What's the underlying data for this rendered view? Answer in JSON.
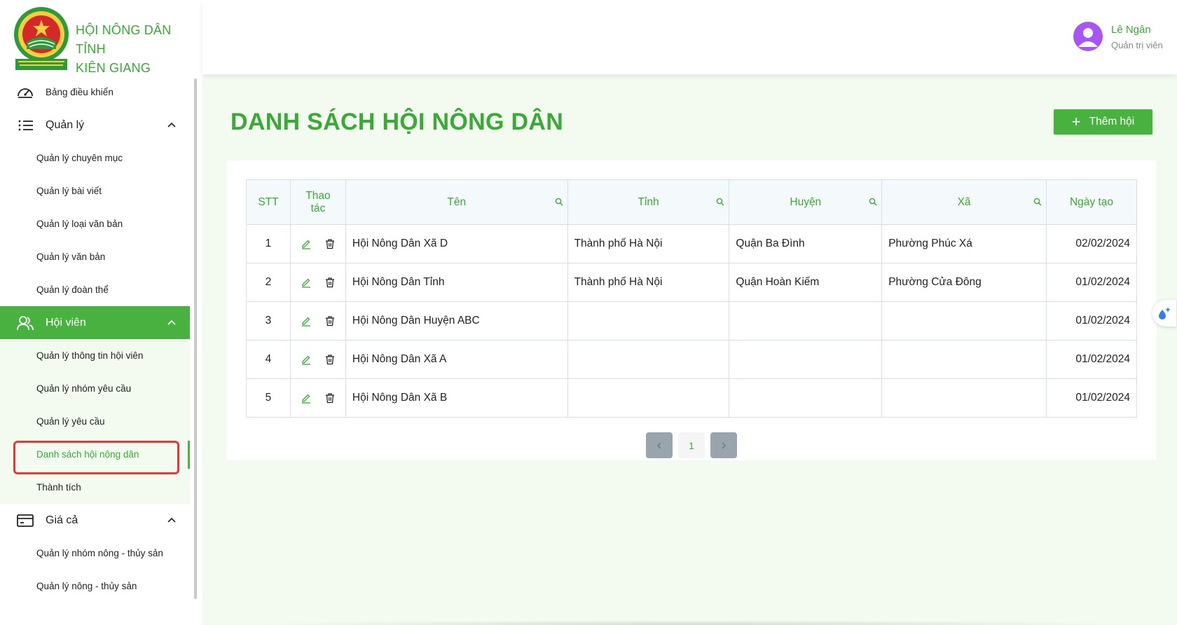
{
  "brand": {
    "name_line1": "HỘI NÔNG DÂN TỈNH",
    "name_line2": "KIÊN GIANG"
  },
  "sidebar": {
    "dashboard": "Bảng điều khiển",
    "groups": [
      {
        "label": "Quản lý",
        "icon": "list-icon",
        "items": [
          "Quản lý chuyên mục",
          "Quản lý bài viết",
          "Quản lý loại văn bản",
          "Quản lý văn bản",
          "Quản lý đoàn thể"
        ]
      },
      {
        "label": "Hội viên",
        "icon": "users-icon",
        "items": [
          "Quản lý thông tin hội viên",
          "Quản lý nhóm yêu cầu",
          "Quản lý yêu cầu",
          "Danh sách hội nông dân",
          "Thành tích"
        ]
      },
      {
        "label": "Giá cả",
        "icon": "card-icon",
        "items": [
          "Quản lý nhóm nông - thủy sản",
          "Quản lý nông - thủy sản"
        ]
      }
    ]
  },
  "header": {
    "user_name": "Lê Ngân",
    "user_role": "Quản trị viên"
  },
  "page": {
    "title": "DANH SÁCH HỘI NÔNG DÂN",
    "add_button": "Thêm hội"
  },
  "table": {
    "headers": {
      "stt": "STT",
      "actions_1": "Thao",
      "actions_2": "tác",
      "name": "Tên",
      "province": "Tỉnh",
      "district": "Huyện",
      "ward": "Xã",
      "created": "Ngày tạo"
    },
    "rows": [
      {
        "stt": "1",
        "name": "Hội Nông Dân Xã D",
        "province": "Thành phố Hà Nội",
        "district": "Quận Ba Đình",
        "ward": "Phường Phúc Xá",
        "created": "02/02/2024"
      },
      {
        "stt": "2",
        "name": "Hội Nông Dân Tỉnh",
        "province": "Thành phố Hà Nội",
        "district": "Quận Hoàn Kiếm",
        "ward": "Phường Cửa Đông",
        "created": "01/02/2024"
      },
      {
        "stt": "3",
        "name": "Hội Nông Dân Huyện ABC",
        "province": "",
        "district": "",
        "ward": "",
        "created": "01/02/2024"
      },
      {
        "stt": "4",
        "name": "Hội Nông Dân Xã A",
        "province": "",
        "district": "",
        "ward": "",
        "created": "01/02/2024"
      },
      {
        "stt": "5",
        "name": "Hội Nông Dân Xã B",
        "province": "",
        "district": "",
        "ward": "",
        "created": "01/02/2024"
      }
    ]
  },
  "pagination": {
    "current": "1"
  },
  "colors": {
    "primary": "#48b140",
    "text_green": "#3aa935",
    "highlight": "#e53935",
    "avatar": "#a855f7"
  }
}
